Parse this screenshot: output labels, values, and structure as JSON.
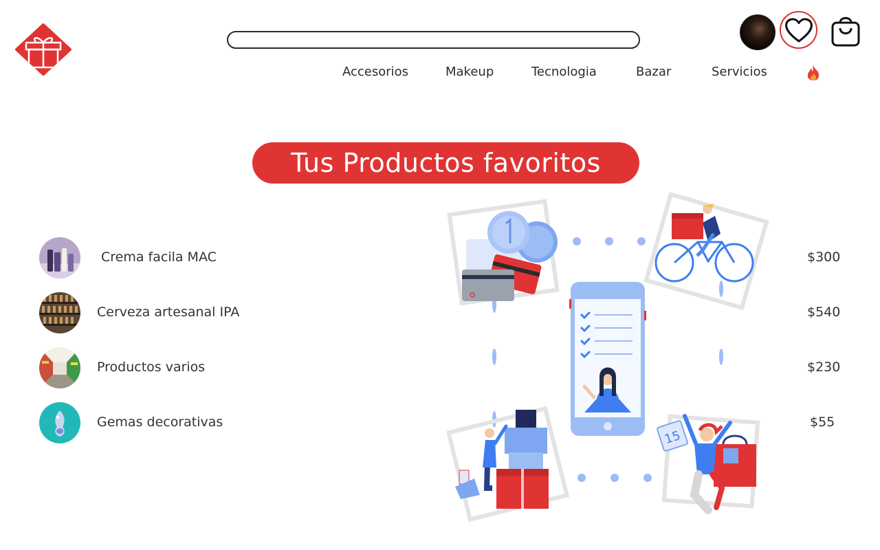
{
  "header": {
    "logo_icon": "gift-icon",
    "search": {
      "placeholder": "",
      "value": ""
    },
    "avatar_icon": "user-avatar",
    "favorites_icon": "heart-icon",
    "cart_icon": "shopping-bag-icon"
  },
  "nav": {
    "items": [
      {
        "label": "Accesorios"
      },
      {
        "label": "Makeup"
      },
      {
        "label": "Tecnologia"
      },
      {
        "label": "Bazar"
      },
      {
        "label": "Servicios"
      }
    ],
    "hot_icon": "flame-icon"
  },
  "page_title": "Tus Productos favoritos",
  "favorites": [
    {
      "name": "Crema facila MAC",
      "price": "$300"
    },
    {
      "name": "Cerveza artesanal IPA",
      "price": "$540"
    },
    {
      "name": "Productos varios",
      "price": "$230"
    },
    {
      "name": "Gemas decorativas",
      "price": "$55"
    }
  ],
  "illustration": {
    "calendar_day": "15"
  },
  "colors": {
    "accent": "#e03434",
    "illustration_blue": "#3f7ef0"
  }
}
